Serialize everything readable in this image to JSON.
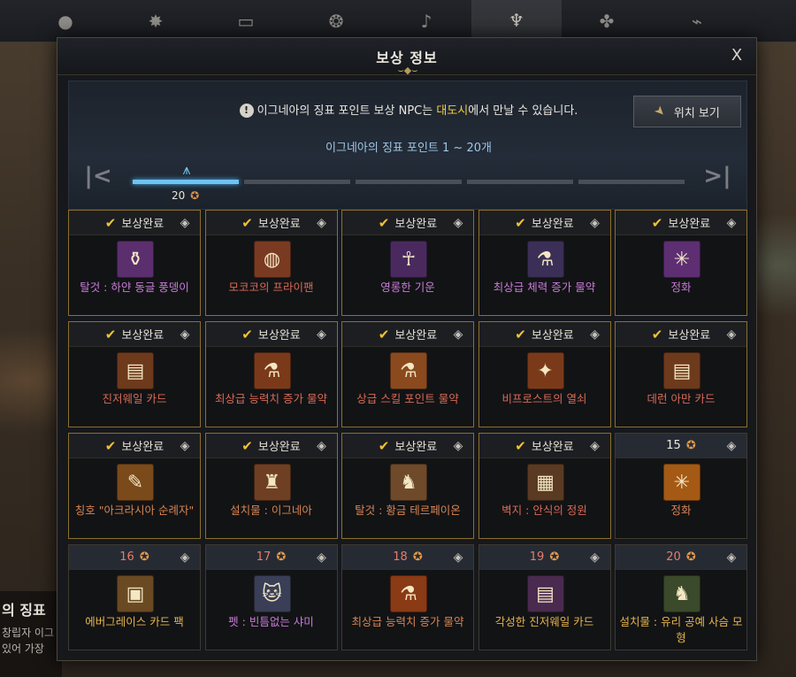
{
  "top_tabs": [
    {
      "icon": "orb-icon"
    },
    {
      "icon": "star-burst-icon"
    },
    {
      "icon": "frame-icon"
    },
    {
      "icon": "shield-emblem-icon"
    },
    {
      "icon": "music-note-icon"
    },
    {
      "icon": "crest-icon",
      "active": true
    },
    {
      "icon": "leaf-icon"
    },
    {
      "icon": "telescope-icon"
    }
  ],
  "background_text": {
    "title_fragment": "의 징표",
    "line1_fragment": "창립자 이그",
    "line2_fragment": "있어 가장 "
  },
  "modal": {
    "title": "보상 정보",
    "close_label": "X",
    "notice": {
      "prefix": "이그네아의 징표 포인트 보상 NPC는 ",
      "highlight": "대도시",
      "suffix": "에서 만날 수 있습니다."
    },
    "locate_button": "위치 보기",
    "range_label": "이그네아의 징표 포인트 1 ~ 20개",
    "progress": {
      "segments": 5,
      "active_segment": 0,
      "count": "20"
    },
    "complete_label": "보상완료"
  },
  "rewards": [
    {
      "status": "done",
      "name": "탈것 : 하얀 동글 풍뎅이",
      "color": "purple",
      "icon_bg": "#5b2e6e",
      "icon": "⚱"
    },
    {
      "status": "done",
      "name": "모코코의 프라이팬",
      "color": "red",
      "icon_bg": "#7a3a22",
      "icon": "◍"
    },
    {
      "status": "done",
      "name": "영롱한 기운",
      "color": "purple",
      "icon_bg": "#4a2a5e",
      "icon": "☥"
    },
    {
      "status": "done",
      "name": "최상급 체력 증가 물약",
      "color": "purple",
      "icon_bg": "#3b2f57",
      "icon": "⚗"
    },
    {
      "status": "done",
      "name": "정화",
      "color": "purple",
      "icon_bg": "#5e2e72",
      "icon": "✳"
    },
    {
      "status": "done",
      "name": "진저웨일 카드",
      "color": "red",
      "icon_bg": "#6e3a1c",
      "icon": "▤"
    },
    {
      "status": "done",
      "name": "최상급 능력치 증가 물약",
      "color": "red",
      "icon_bg": "#7a3a1a",
      "icon": "⚗"
    },
    {
      "status": "done",
      "name": "상급 스킬 포인트 물약",
      "color": "red",
      "icon_bg": "#8a4a1e",
      "icon": "⚗"
    },
    {
      "status": "done",
      "name": "비프로스트의 열쇠",
      "color": "red",
      "icon_bg": "#7a3a1a",
      "icon": "✦"
    },
    {
      "status": "done",
      "name": "데런 아만 카드",
      "color": "red",
      "icon_bg": "#6e3a1c",
      "icon": "▤"
    },
    {
      "status": "done",
      "name": "칭호 \"아크라시아 순례자\"",
      "color": "orange",
      "icon_bg": "#7a4a1a",
      "icon": "✎"
    },
    {
      "status": "done",
      "name": "설치물 : 이그네아",
      "color": "orange",
      "icon_bg": "#6e3f22",
      "icon": "♜"
    },
    {
      "status": "done",
      "name": "탈것 : 황금 테르페이온",
      "color": "orange",
      "icon_bg": "#6e4a2a",
      "icon": "♞"
    },
    {
      "status": "done",
      "name": "벽지 : 안식의 정원",
      "color": "red",
      "icon_bg": "#5a3a22",
      "icon": "▦"
    },
    {
      "status": "pending",
      "required": "15",
      "name": "정화",
      "color": "orange",
      "icon_bg": "#a45a14",
      "icon": "✳",
      "cleared": true
    },
    {
      "status": "pending",
      "required": "16",
      "name": "에버그레이스 카드 팩",
      "color": "gold",
      "icon_bg": "#6a4a22",
      "icon": "▣"
    },
    {
      "status": "pending",
      "required": "17",
      "name": "펫 : 빈틈없는 샤미",
      "color": "purple",
      "icon_bg": "#3a3f57",
      "icon": "🐱"
    },
    {
      "status": "pending",
      "required": "18",
      "name": "최상급 능력치 증가 물약",
      "color": "orange",
      "icon_bg": "#8a3a14",
      "icon": "⚗"
    },
    {
      "status": "pending",
      "required": "19",
      "name": "각성한 진저웨일 카드",
      "color": "gold",
      "icon_bg": "#4a2a4e",
      "icon": "▤"
    },
    {
      "status": "pending",
      "required": "20",
      "name": "설치물 : 유리 공예 사슴 모형",
      "color": "gold",
      "icon_bg": "#3a4a2a",
      "icon": "♞"
    }
  ]
}
